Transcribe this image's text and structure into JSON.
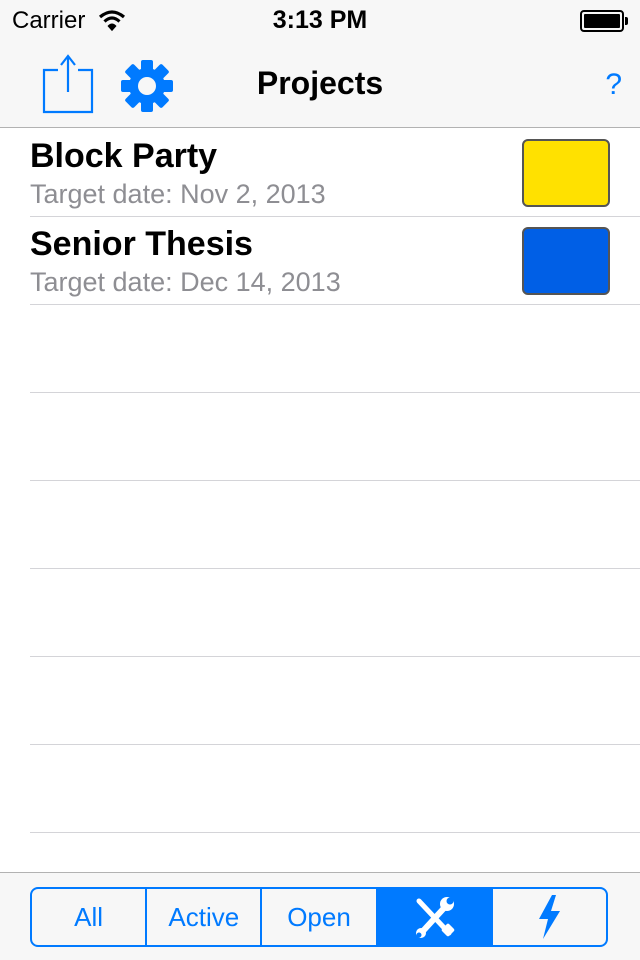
{
  "status_bar": {
    "carrier": "Carrier",
    "time": "3:13 PM",
    "wifi_icon": "wifi-icon",
    "battery_icon": "battery-full-icon"
  },
  "nav": {
    "title": "Projects",
    "share_icon": "share-icon",
    "settings_icon": "gear-icon",
    "help_label": "?"
  },
  "projects": [
    {
      "name": "Block Party",
      "target_date": "Target date: Nov 2, 2013",
      "color": "#ffe100"
    },
    {
      "name": "Senior Thesis",
      "target_date": "Target date: Dec 14, 2013",
      "color": "#005fe6"
    }
  ],
  "filter": {
    "segments": [
      {
        "label": "All"
      },
      {
        "label": "Active"
      },
      {
        "label": "Open"
      },
      {
        "icon": "tools-icon",
        "selected": true
      },
      {
        "icon": "lightning-bolt-icon"
      }
    ]
  },
  "colors": {
    "accent": "#007aff",
    "bar_background": "#f7f7f7",
    "separator": "#d4d4d8",
    "subtitle": "#8e8e93"
  }
}
